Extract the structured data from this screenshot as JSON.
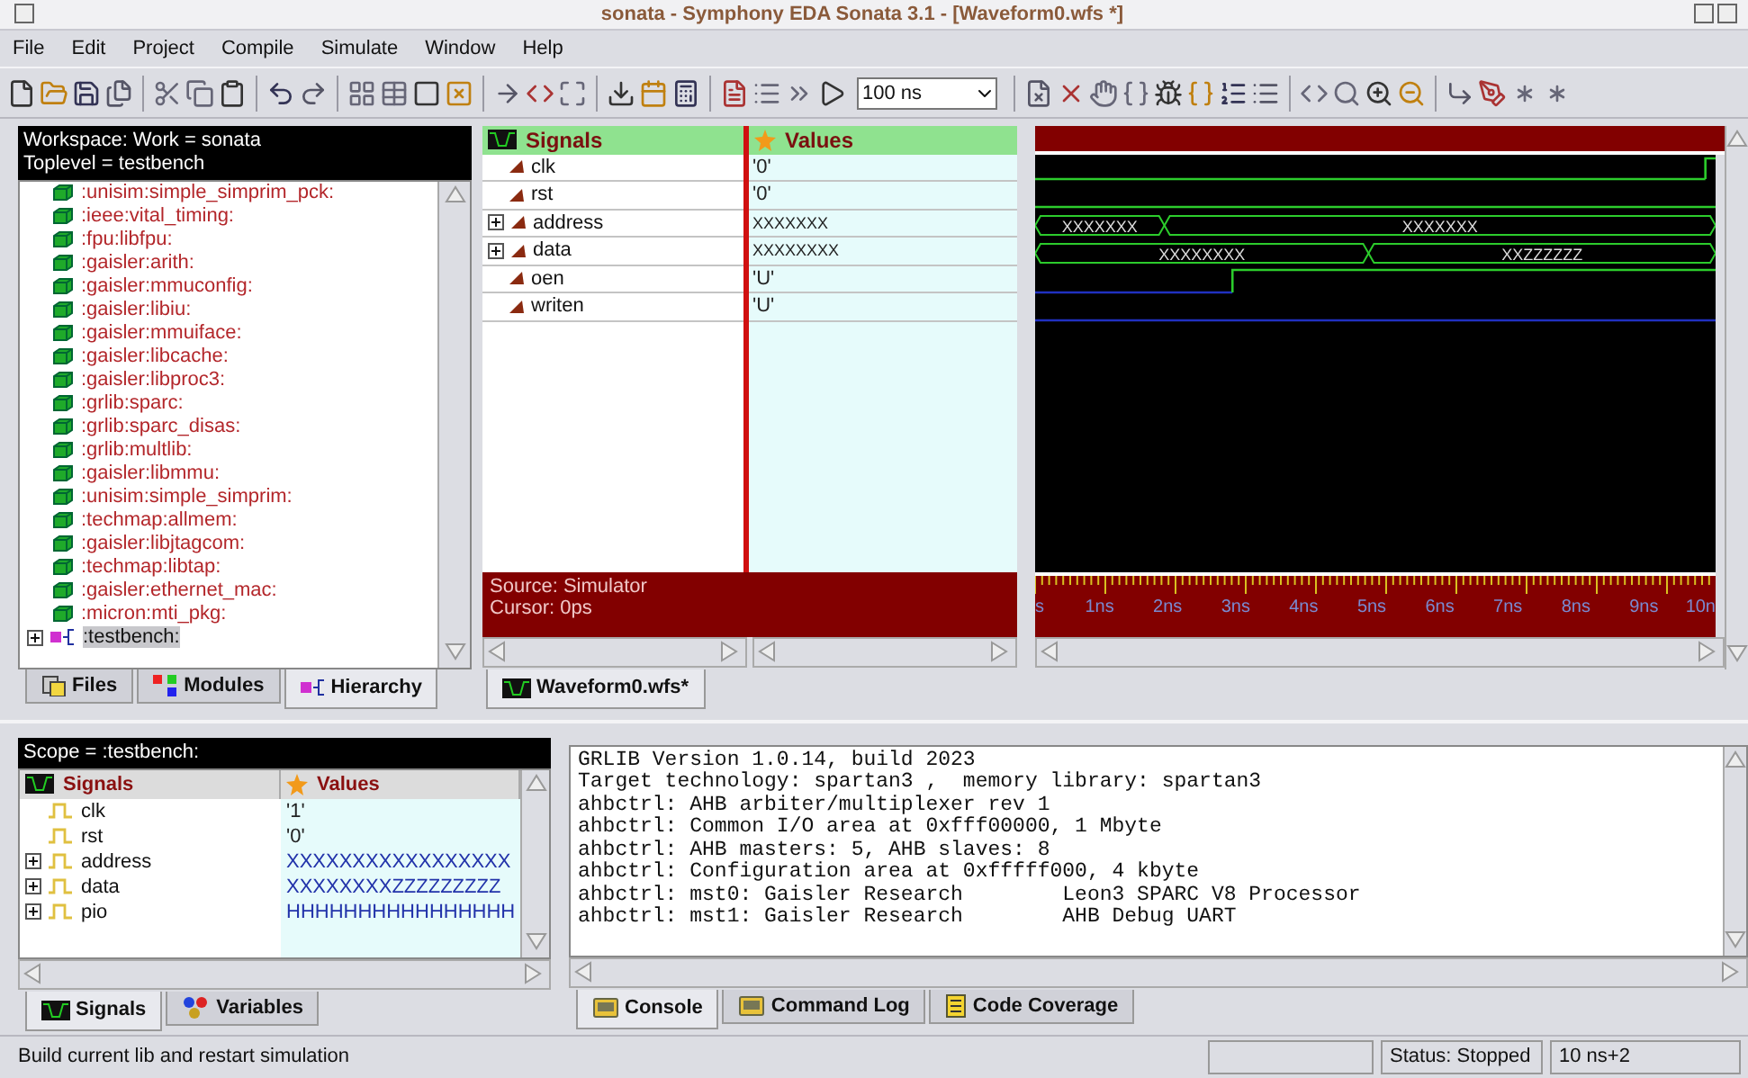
{
  "window": {
    "title": "sonata - Symphony EDA Sonata 3.1 - [Waveform0.wfs *]"
  },
  "menu": [
    "File",
    "Edit",
    "Project",
    "Compile",
    "Simulate",
    "Window",
    "Help"
  ],
  "toolbar": {
    "time_step": "100 ns"
  },
  "workspace": {
    "header": [
      "Workspace: Work = sonata",
      "Toplevel = testbench"
    ],
    "tree": [
      {
        "label": ":unisim:simple_simprim_pck:",
        "kind": "library",
        "selected": false
      },
      {
        "label": ":ieee:vital_timing:",
        "kind": "library",
        "selected": false
      },
      {
        "label": ":fpu:libfpu:",
        "kind": "library",
        "selected": false
      },
      {
        "label": ":gaisler:arith:",
        "kind": "library",
        "selected": false
      },
      {
        "label": ":gaisler:mmuconfig:",
        "kind": "library",
        "selected": false
      },
      {
        "label": ":gaisler:libiu:",
        "kind": "library",
        "selected": false
      },
      {
        "label": ":gaisler:mmuiface:",
        "kind": "library",
        "selected": false
      },
      {
        "label": ":gaisler:libcache:",
        "kind": "library",
        "selected": false
      },
      {
        "label": ":gaisler:libproc3:",
        "kind": "library",
        "selected": false
      },
      {
        "label": ":grlib:sparc:",
        "kind": "library",
        "selected": false
      },
      {
        "label": ":grlib:sparc_disas:",
        "kind": "library",
        "selected": false
      },
      {
        "label": ":grlib:multlib:",
        "kind": "library",
        "selected": false
      },
      {
        "label": ":gaisler:libmmu:",
        "kind": "library",
        "selected": false
      },
      {
        "label": ":unisim:simple_simprim:",
        "kind": "library",
        "selected": false
      },
      {
        "label": ":techmap:allmem:",
        "kind": "library",
        "selected": false
      },
      {
        "label": ":gaisler:libjtagcom:",
        "kind": "library",
        "selected": false
      },
      {
        "label": ":techmap:libtap:",
        "kind": "library",
        "selected": false
      },
      {
        "label": ":gaisler:ethernet_mac:",
        "kind": "library",
        "selected": false
      },
      {
        "label": ":micron:mti_pkg:",
        "kind": "library",
        "selected": false
      },
      {
        "label": ":testbench:",
        "kind": "module",
        "selected": true,
        "expanded": false
      }
    ],
    "tabs": [
      {
        "label": "Files",
        "selected": false
      },
      {
        "label": "Modules",
        "selected": false
      },
      {
        "label": "Hierarchy",
        "selected": true
      }
    ]
  },
  "waveform": {
    "signals_header": "Signals",
    "values_header": "Values",
    "signals": [
      {
        "name": "clk",
        "value": "'0'",
        "kind": "bit"
      },
      {
        "name": "rst",
        "value": "'0'",
        "kind": "bit"
      },
      {
        "name": "address",
        "value": "XXXXXXX",
        "kind": "bus",
        "expanded": false,
        "segments": [
          "XXXXXXX",
          "XXXXXXX"
        ]
      },
      {
        "name": "data",
        "value": "XXXXXXXX",
        "kind": "bus",
        "expanded": false,
        "segments": [
          "XXXXXXXX",
          "XXZZZZZZ"
        ]
      },
      {
        "name": "oen",
        "value": "'U'",
        "kind": "bit"
      },
      {
        "name": "writen",
        "value": "'U'",
        "kind": "bit"
      }
    ],
    "source": "Source: Simulator",
    "cursor": "Cursor: 0ps",
    "time_labels": [
      "s",
      "1ns",
      "2ns",
      "3ns",
      "4ns",
      "5ns",
      "6ns",
      "7ns",
      "8ns",
      "9ns",
      "10n"
    ],
    "tabs": [
      {
        "label": "Waveform0.wfs*",
        "selected": true
      }
    ]
  },
  "scope": {
    "header": "Scope = :testbench:",
    "signals_header": "Signals",
    "values_header": "Values",
    "rows": [
      {
        "name": "clk",
        "value": "'1'",
        "kind": "bit"
      },
      {
        "name": "rst",
        "value": "'0'",
        "kind": "bit"
      },
      {
        "name": "address",
        "value": "XXXXXXXXXXXXXXXXX",
        "kind": "bus",
        "expanded": false
      },
      {
        "name": "data",
        "value": "XXXXXXXXZZZZZZZZZ",
        "kind": "bus",
        "expanded": false
      },
      {
        "name": "pio",
        "value": "HHHHHHHHHHHHHHHH",
        "kind": "bus",
        "expanded": false
      }
    ],
    "tabs": [
      {
        "label": "Signals",
        "selected": true
      },
      {
        "label": "Variables",
        "selected": false
      }
    ]
  },
  "console": {
    "lines": [
      "GRLIB Version 1.0.14, build 2023",
      "Target technology: spartan3 ,  memory library: spartan3",
      "ahbctrl: AHB arbiter/multiplexer rev 1",
      "ahbctrl: Common I/O area at 0xfff00000, 1 Mbyte",
      "ahbctrl: AHB masters: 5, AHB slaves: 8",
      "ahbctrl: Configuration area at 0xfffff000, 4 kbyte",
      "ahbctrl: mst0: Gaisler Research        Leon3 SPARC V8 Processor",
      "ahbctrl: mst1: Gaisler Research        AHB Debug UART"
    ],
    "tabs": [
      {
        "label": "Console",
        "selected": true
      },
      {
        "label": "Command Log",
        "selected": false
      },
      {
        "label": "Code Coverage",
        "selected": false
      }
    ]
  },
  "status_bar": {
    "message": "Build current lib and restart simulation",
    "status": "Status: Stopped",
    "time": "10 ns+2"
  }
}
